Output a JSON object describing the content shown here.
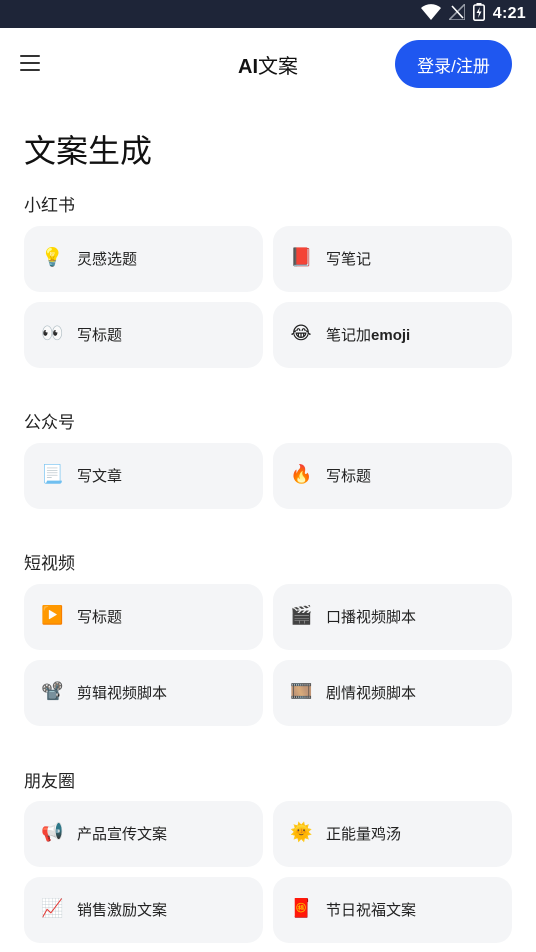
{
  "status_bar": {
    "time": "4:21",
    "icons": [
      "wifi-icon",
      "no-signal-icon",
      "battery-charging-icon"
    ]
  },
  "app_bar": {
    "title_prefix": "AI",
    "title_suffix": "文案",
    "login_label": "登录/注册",
    "accent_color": "#1f57f0"
  },
  "page_title": "文案生成",
  "sections": [
    {
      "label": "小红书",
      "cards": [
        {
          "icon": "lightbulb-icon",
          "glyph": "💡",
          "label": "灵感选题"
        },
        {
          "icon": "red-book-icon",
          "glyph": "📕",
          "label": "写笔记"
        },
        {
          "icon": "eyes-icon",
          "glyph": "👀",
          "label": "写标题"
        },
        {
          "icon": "laughing-face-icon",
          "glyph": "😂",
          "label_main": "笔记加",
          "label_bold": "emoji"
        }
      ]
    },
    {
      "label": "公众号",
      "cards": [
        {
          "icon": "document-icon",
          "glyph": "📃",
          "label": "写文章"
        },
        {
          "icon": "fire-icon",
          "glyph": "🔥",
          "label": "写标题"
        }
      ]
    },
    {
      "label": "短视频",
      "cards": [
        {
          "icon": "play-button-icon",
          "glyph": "▶️",
          "label": "写标题"
        },
        {
          "icon": "clapper-board-icon",
          "glyph": "🎬",
          "label": "口播视频脚本"
        },
        {
          "icon": "film-projector-icon",
          "glyph": "📽️",
          "label": "剪辑视频脚本"
        },
        {
          "icon": "film-frames-icon",
          "glyph": "🎞️",
          "label": "剧情视频脚本"
        }
      ]
    },
    {
      "label": "朋友圈",
      "cards": [
        {
          "icon": "loudspeaker-icon",
          "glyph": "📢",
          "label": "产品宣传文案"
        },
        {
          "icon": "sun-face-icon",
          "glyph": "🌞",
          "label": "正能量鸡汤"
        },
        {
          "icon": "chart-increasing-icon",
          "glyph": "📈",
          "label": "销售激励文案"
        },
        {
          "icon": "red-envelope-icon",
          "glyph": "🧧",
          "label": "节日祝福文案"
        }
      ]
    }
  ]
}
